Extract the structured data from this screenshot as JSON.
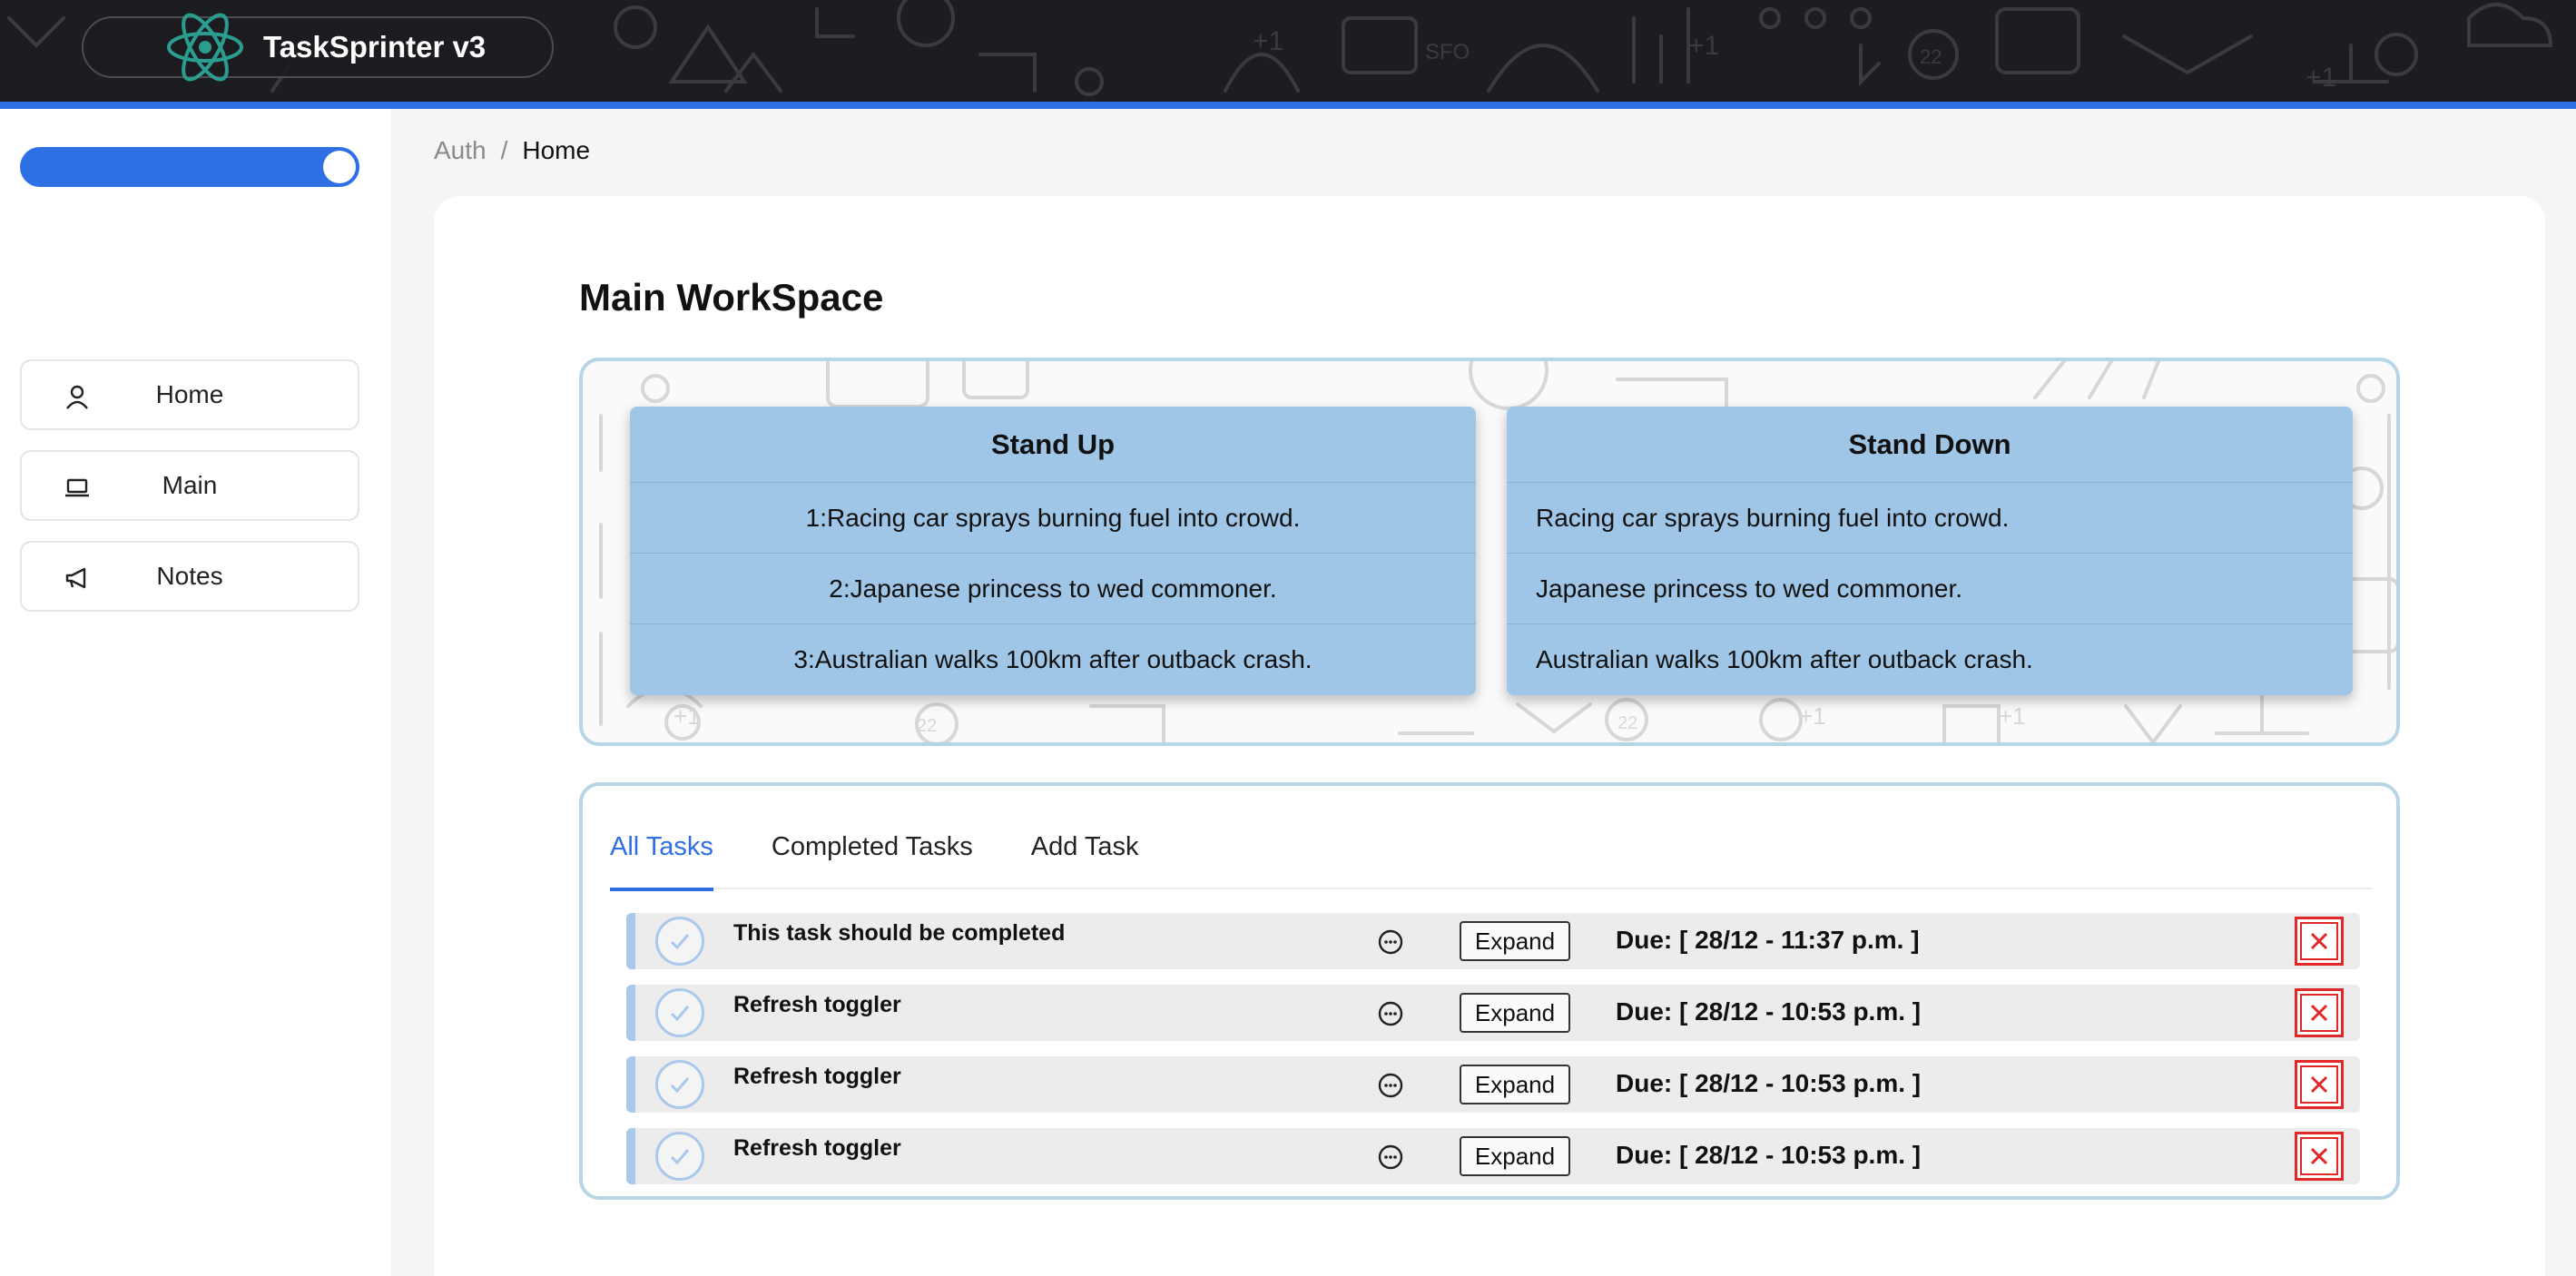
{
  "header": {
    "title": "TaskSprinter v3",
    "logo_icon": "react-atom-icon",
    "accent_color": "#2f6fe4"
  },
  "sidebar": {
    "toggle_state": "on",
    "items": [
      {
        "label": "Home",
        "icon": "user-icon"
      },
      {
        "label": "Main",
        "icon": "laptop-icon"
      },
      {
        "label": "Notes",
        "icon": "megaphone-icon"
      }
    ]
  },
  "breadcrumb": {
    "items": [
      "Auth",
      "Home"
    ],
    "separator": "/"
  },
  "workspace": {
    "title": "Main WorkSpace",
    "stand_up": {
      "heading": "Stand Up",
      "items": [
        "1:Racing car sprays burning fuel into crowd.",
        "2:Japanese princess to wed commoner.",
        "3:Australian walks 100km after outback crash."
      ]
    },
    "stand_down": {
      "heading": "Stand Down",
      "items": [
        "Racing car sprays burning fuel into crowd.",
        "Japanese princess to wed commoner.",
        "Australian walks 100km after outback crash."
      ]
    }
  },
  "tasks": {
    "tabs": [
      {
        "label": "All Tasks",
        "active": true
      },
      {
        "label": "Completed Tasks",
        "active": false
      },
      {
        "label": "Add Task",
        "active": false
      }
    ],
    "expand_label": "Expand",
    "rows": [
      {
        "title": "This task should be completed",
        "due": "Due: [ 28/12 - 11:37 p.m. ]"
      },
      {
        "title": "Refresh toggler",
        "due": "Due: [ 28/12 - 10:53 p.m. ]"
      },
      {
        "title": "Refresh toggler",
        "due": "Due: [ 28/12 - 10:53 p.m. ]"
      },
      {
        "title": "Refresh toggler",
        "due": "Due: [ 28/12 - 10:53 p.m. ]"
      }
    ],
    "colors": {
      "check": "#a9c8ec",
      "delete": "#e02828",
      "active_tab": "#2f6fe4"
    }
  }
}
